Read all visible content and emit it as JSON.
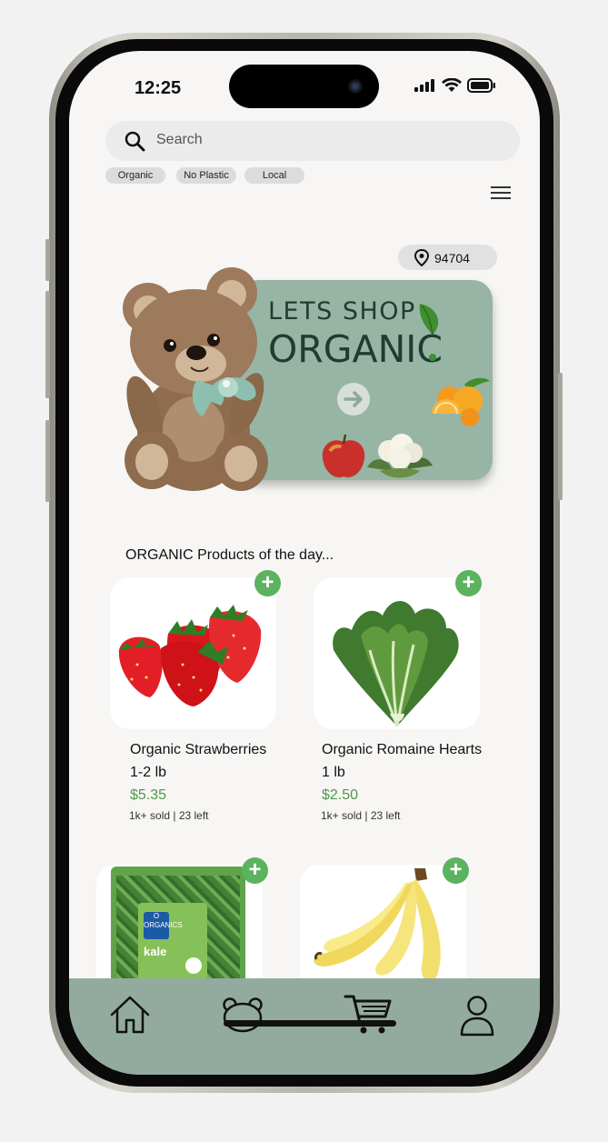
{
  "status_bar": {
    "time": "12:25"
  },
  "search": {
    "placeholder": "Search"
  },
  "filters": [
    {
      "label": "Organic"
    },
    {
      "label": "No Plastic"
    },
    {
      "label": "Local"
    }
  ],
  "location": {
    "zip": "94704"
  },
  "banner": {
    "line1": "LETS SHOP",
    "line2": "ORGANIC",
    "exclaim": "!"
  },
  "section": {
    "title": "ORGANIC Products of the day..."
  },
  "products": [
    {
      "name": "Organic Strawberries",
      "weight": "1-2 lb",
      "price": "$5.35",
      "sold": "1k+ sold | 23 left"
    },
    {
      "name": "Organic Romaine Hearts",
      "weight": "1 lb",
      "price": "$2.50",
      "sold": "1k+ sold | 23 left"
    },
    {
      "name": "",
      "package_text": "kale",
      "brand_text": "O ORGANICS"
    },
    {
      "name": ""
    }
  ],
  "bottom_nav": {
    "items": [
      {
        "icon": "home-icon"
      },
      {
        "icon": "bear-icon"
      },
      {
        "icon": "cart-icon"
      },
      {
        "icon": "profile-icon"
      }
    ]
  },
  "colors": {
    "accent_green": "#5bb25f",
    "price_green": "#4f9a4d",
    "sage": "#93ab9f",
    "banner_bg": "#97b5a5"
  }
}
